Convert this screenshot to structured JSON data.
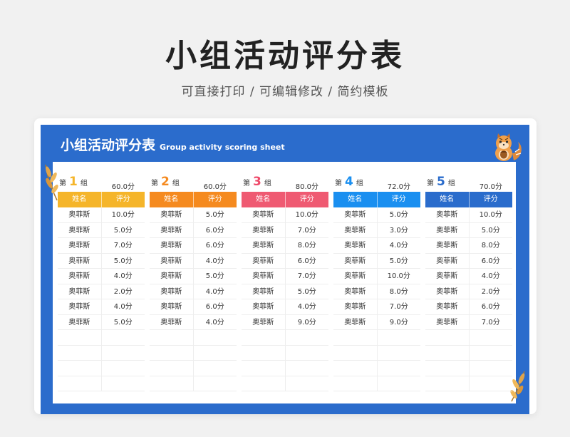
{
  "header": {
    "title": "小组活动评分表",
    "subtitle": "可直接打印 /  可编辑修改  / 简约模板"
  },
  "sheet": {
    "title_cn": "小组活动评分表",
    "title_en": "Group activity scoring sheet",
    "label_prefix": "第",
    "label_suffix": "组",
    "col_name": "姓名",
    "col_score": "评分"
  },
  "groups": [
    {
      "number": "1",
      "total": "60.0分",
      "color": "#f5b52a",
      "num_color": "#f5b52a",
      "rows": [
        {
          "name": "奥菲斯",
          "score": "10.0分"
        },
        {
          "name": "奥菲斯",
          "score": "5.0分"
        },
        {
          "name": "奥菲斯",
          "score": "7.0分"
        },
        {
          "name": "奥菲斯",
          "score": "5.0分"
        },
        {
          "name": "奥菲斯",
          "score": "4.0分"
        },
        {
          "name": "奥菲斯",
          "score": "2.0分"
        },
        {
          "name": "奥菲斯",
          "score": "4.0分"
        },
        {
          "name": "奥菲斯",
          "score": "5.0分"
        },
        {
          "name": "",
          "score": ""
        },
        {
          "name": "",
          "score": ""
        },
        {
          "name": "",
          "score": ""
        },
        {
          "name": "",
          "score": ""
        }
      ]
    },
    {
      "number": "2",
      "total": "60.0分",
      "color": "#f58a1f",
      "num_color": "#f58a1f",
      "rows": [
        {
          "name": "奥菲斯",
          "score": "5.0分"
        },
        {
          "name": "奥菲斯",
          "score": "6.0分"
        },
        {
          "name": "奥菲斯",
          "score": "6.0分"
        },
        {
          "name": "奥菲斯",
          "score": "4.0分"
        },
        {
          "name": "奥菲斯",
          "score": "5.0分"
        },
        {
          "name": "奥菲斯",
          "score": "4.0分"
        },
        {
          "name": "奥菲斯",
          "score": "6.0分"
        },
        {
          "name": "奥菲斯",
          "score": "4.0分"
        },
        {
          "name": "",
          "score": ""
        },
        {
          "name": "",
          "score": ""
        },
        {
          "name": "",
          "score": ""
        },
        {
          "name": "",
          "score": ""
        }
      ]
    },
    {
      "number": "3",
      "total": "80.0分",
      "color": "#ef5a72",
      "num_color": "#ef4a6a",
      "rows": [
        {
          "name": "奥菲斯",
          "score": "10.0分"
        },
        {
          "name": "奥菲斯",
          "score": "7.0分"
        },
        {
          "name": "奥菲斯",
          "score": "8.0分"
        },
        {
          "name": "奥菲斯",
          "score": "6.0分"
        },
        {
          "name": "奥菲斯",
          "score": "7.0分"
        },
        {
          "name": "奥菲斯",
          "score": "5.0分"
        },
        {
          "name": "奥菲斯",
          "score": "4.0分"
        },
        {
          "name": "奥菲斯",
          "score": "9.0分"
        },
        {
          "name": "",
          "score": ""
        },
        {
          "name": "",
          "score": ""
        },
        {
          "name": "",
          "score": ""
        },
        {
          "name": "",
          "score": ""
        }
      ]
    },
    {
      "number": "4",
      "total": "72.0分",
      "color": "#1a8ff0",
      "num_color": "#1a8ff0",
      "rows": [
        {
          "name": "奥菲斯",
          "score": "5.0分"
        },
        {
          "name": "奥菲斯",
          "score": "3.0分"
        },
        {
          "name": "奥菲斯",
          "score": "4.0分"
        },
        {
          "name": "奥菲斯",
          "score": "5.0分"
        },
        {
          "name": "奥菲斯",
          "score": "10.0分"
        },
        {
          "name": "奥菲斯",
          "score": "8.0分"
        },
        {
          "name": "奥菲斯",
          "score": "7.0分"
        },
        {
          "name": "奥菲斯",
          "score": "9.0分"
        },
        {
          "name": "",
          "score": ""
        },
        {
          "name": "",
          "score": ""
        },
        {
          "name": "",
          "score": ""
        },
        {
          "name": "",
          "score": ""
        }
      ]
    },
    {
      "number": "5",
      "total": "70.0分",
      "color": "#2a6ccc",
      "num_color": "#2a6ccc",
      "rows": [
        {
          "name": "奥菲斯",
          "score": "10.0分"
        },
        {
          "name": "奥菲斯",
          "score": "5.0分"
        },
        {
          "name": "奥菲斯",
          "score": "8.0分"
        },
        {
          "name": "奥菲斯",
          "score": "6.0分"
        },
        {
          "name": "奥菲斯",
          "score": "4.0分"
        },
        {
          "name": "奥菲斯",
          "score": "2.0分"
        },
        {
          "name": "奥菲斯",
          "score": "6.0分"
        },
        {
          "name": "奥菲斯",
          "score": "7.0分"
        },
        {
          "name": "",
          "score": ""
        },
        {
          "name": "",
          "score": ""
        },
        {
          "name": "",
          "score": ""
        },
        {
          "name": "",
          "score": ""
        }
      ]
    }
  ]
}
